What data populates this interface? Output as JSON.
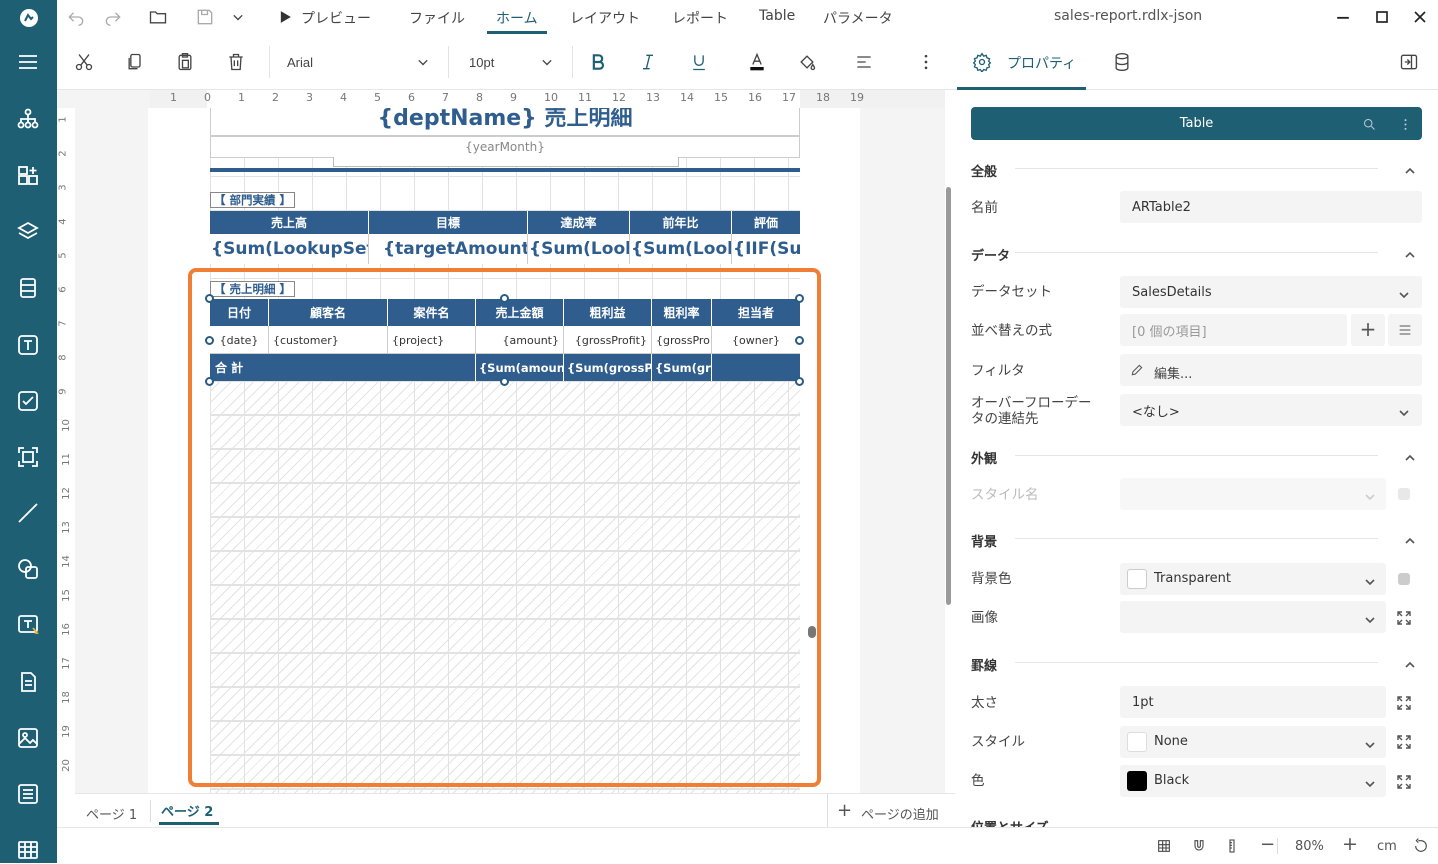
{
  "title_bar": {
    "file_name": "sales-report.rdlx-json",
    "menus": [
      "プレビュー",
      "ファイル",
      "ホーム",
      "レイアウト",
      "レポート",
      "Table",
      "パラメータ"
    ],
    "active_menu": "ホーム"
  },
  "toolbar": {
    "font_family": "Arial",
    "font_size": "10pt",
    "properties_tab": "プロパティ"
  },
  "ruler": {
    "h_ticks": [
      "1",
      "0",
      "1",
      "2",
      "3",
      "4",
      "5",
      "6",
      "7",
      "8",
      "9",
      "10",
      "11",
      "12",
      "13",
      "14",
      "15",
      "16",
      "17",
      "18",
      "19"
    ],
    "v_ticks": [
      "1",
      "2",
      "3",
      "4",
      "5",
      "6",
      "7",
      "8",
      "9",
      "10",
      "11",
      "12",
      "13",
      "14",
      "15",
      "16",
      "17",
      "18",
      "19",
      "20"
    ]
  },
  "report": {
    "title_text": "{deptName} 売上明細",
    "year_month": "{yearMonth}",
    "summary_label": "【 部門実績 】",
    "summary_headers": [
      "売上高",
      "目標",
      "達成率",
      "前年比",
      "評価"
    ],
    "summary_values": [
      "{Sum(LookupSet(",
      "{targetAmount}",
      "{Sum(Look",
      "{Sum(Look",
      "{IIF(Su"
    ],
    "detail_label": "【 売上明細 】",
    "detail_headers": [
      "日付",
      "顧客名",
      "案件名",
      "売上金額",
      "粗利益",
      "粗利率",
      "担当者"
    ],
    "detail_values": [
      "{date}",
      "{customer}",
      "{project}",
      "{amount}",
      "{grossProfit}",
      "{grossPro",
      "{owner}"
    ],
    "total_label": "合 計",
    "total_values": [
      "{Sum(amount",
      "{Sum(grossPr",
      "{Sum(gr"
    ]
  },
  "page_tabs": {
    "tabs": [
      "ページ 1",
      "ページ 2"
    ],
    "active": "ページ 2",
    "add_label": "ページの追加"
  },
  "status": {
    "zoom": "80%",
    "unit": "cm"
  },
  "properties": {
    "header": "Table",
    "sections": {
      "general": "全般",
      "data": "データ",
      "appearance": "外観",
      "background": "背景",
      "border": "罫線",
      "position": "位置とサイズ"
    },
    "name_label": "名前",
    "name_value": "ARTable2",
    "dataset_label": "データセット",
    "dataset_value": "SalesDetails",
    "sort_label": "並べ替えの式",
    "sort_value": "[0 個の項目]",
    "filter_label": "フィルタ",
    "filter_value": "編集...",
    "overflow_label_1": "オーバーフローデー",
    "overflow_label_2": "タの連結先",
    "overflow_value": "<なし>",
    "style_name_label": "スタイル名",
    "bg_color_label": "背景色",
    "bg_color_value": "Transparent",
    "image_label": "画像",
    "width_label": "太さ",
    "width_value": "1pt",
    "style_label": "スタイル",
    "style_value": "None",
    "color_label": "色",
    "color_value": "Black"
  },
  "colors": {
    "sidebar": "#1e5f73",
    "accent": "#1e5f73",
    "table_header": "#2e5d8e",
    "selection": "#f07f35"
  }
}
